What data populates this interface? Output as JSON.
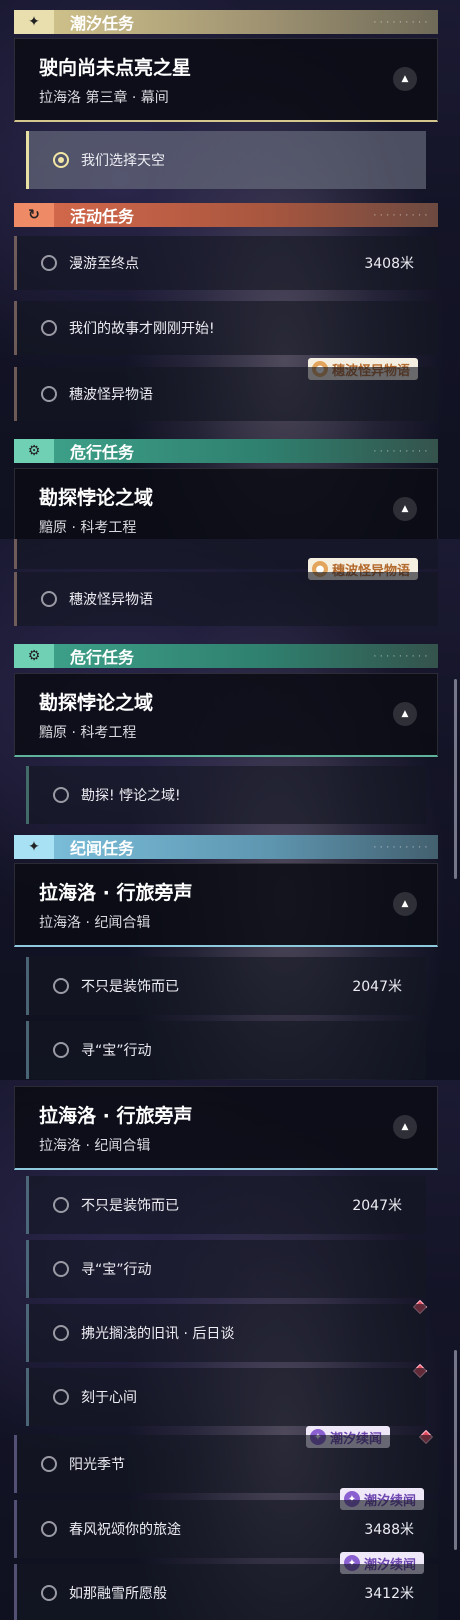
{
  "frame1": {
    "tidal_header": "潮汐任务",
    "tidal_card": {
      "title": "驶向尚未点亮之星",
      "subtitle": "拉海洛 第三章 · 幕间"
    },
    "selected_task": "我们选择天空",
    "event_header": "活动任务",
    "event_tasks": [
      {
        "name": "漫游至终点",
        "distance": "3408米"
      },
      {
        "name": "我们的故事才刚刚开始!",
        "distance": ""
      },
      {
        "name": "穗波怪异物语",
        "distance": ""
      }
    ],
    "event_badge": "穗波怪异物语",
    "danger_header": "危行任务",
    "danger_card": {
      "title": "勘探悖论之域",
      "subtitle": "黯原 · 科考工程"
    }
  },
  "frame2": {
    "event_badge": "穗波怪异物语",
    "event_task": "穗波怪异物语",
    "danger_header": "危行任务",
    "danger_card": {
      "title": "勘探悖论之域",
      "subtitle": "黯原 · 科考工程"
    },
    "danger_task": "勘探! 悖论之域!",
    "chronicle_header": "纪闻任务",
    "chronicle_card": {
      "title": "拉海洛 · 行旅旁声",
      "subtitle": "拉海洛 · 纪闻合辑"
    },
    "chronicle_tasks": [
      {
        "name": "不只是装饰而已",
        "distance": "2047米"
      },
      {
        "name": "寻“宝”行动",
        "distance": ""
      }
    ]
  },
  "frame3": {
    "chronicle_card": {
      "title": "拉海洛 · 行旅旁声",
      "subtitle": "拉海洛 · 纪闻合辑"
    },
    "chronicle_tasks": [
      {
        "name": "不只是装饰而已",
        "distance": "2047米"
      },
      {
        "name": "寻“宝”行动",
        "distance": ""
      },
      {
        "name": "拂光搁浅的旧讯 · 后日谈",
        "distance": ""
      },
      {
        "name": "刻于心间",
        "distance": ""
      }
    ],
    "tidal_tasks": [
      {
        "name": "阳光季节",
        "distance": ""
      },
      {
        "name": "春风祝颂你的旅途",
        "distance": "3488米"
      },
      {
        "name": "如那融雪所愿般",
        "distance": "3412米"
      }
    ],
    "tidal_badge": "潮汐续闻"
  },
  "icons": {
    "tidal": "sparkle-icon",
    "event": "refresh-icon",
    "danger": "gear-icon",
    "chronicle": "sparkle-icon",
    "collapse": "triangle-up-icon",
    "radio": "radio-icon",
    "alert": "diamond-icon"
  },
  "colors": {
    "tidal": "#d7c98e",
    "event": "#d96a4d",
    "danger": "#3fa58c",
    "chronicle": "#7fc4e0",
    "alert": "#e34a5c",
    "badge_purple": "#8a5fd0",
    "badge_orange": "#e3a55d"
  }
}
